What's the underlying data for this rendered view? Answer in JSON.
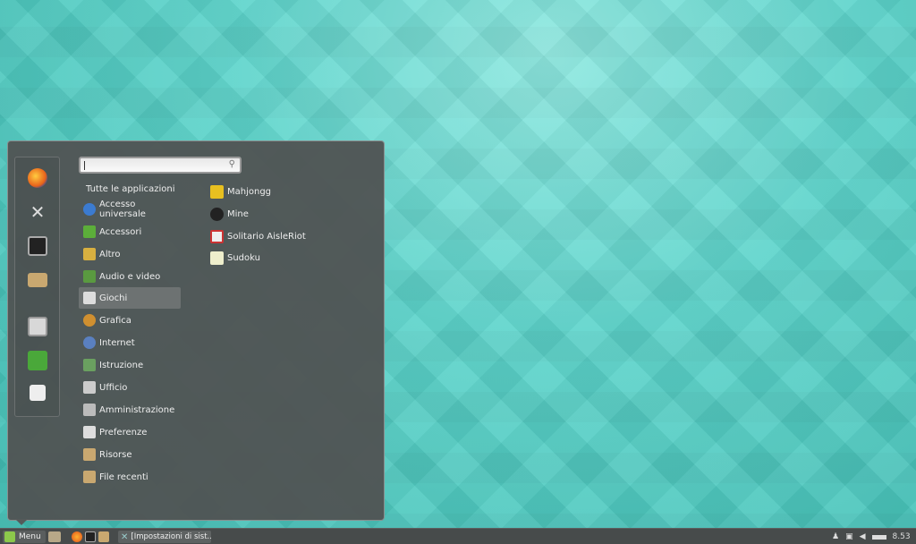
{
  "menu": {
    "search": {
      "placeholder": ""
    },
    "favorites": [
      {
        "name": "firefox-icon"
      },
      {
        "name": "system-settings-icon"
      },
      {
        "name": "terminal-icon"
      },
      {
        "name": "folder-icon"
      },
      {
        "name": "lock-screen-icon"
      },
      {
        "name": "logout-icon"
      },
      {
        "name": "shutdown-icon"
      }
    ],
    "categories": [
      {
        "label": "Tutte le applicazioni"
      },
      {
        "label": "Accesso universale",
        "color": "#3b7bd0"
      },
      {
        "label": "Accessori",
        "color": "#5cae3a"
      },
      {
        "label": "Altro",
        "color": "#d8b040"
      },
      {
        "label": "Audio e video",
        "color": "#5a9a40"
      },
      {
        "label": "Giochi",
        "color": "#dddddd",
        "selected": true
      },
      {
        "label": "Grafica",
        "color": "#d09030"
      },
      {
        "label": "Internet",
        "color": "#5a80c0"
      },
      {
        "label": "Istruzione",
        "color": "#6aa060"
      },
      {
        "label": "Ufficio",
        "color": "#cccccc"
      },
      {
        "label": "Amministrazione",
        "color": "#bbbbbb"
      },
      {
        "label": "Preferenze",
        "color": "#dddddd"
      },
      {
        "label": "Risorse",
        "color": "#c9a870"
      },
      {
        "label": "File recenti",
        "color": "#c9a870"
      }
    ],
    "apps": [
      {
        "label": "Mahjongg",
        "color": "#e8c020"
      },
      {
        "label": "Mine",
        "color": "#222222"
      },
      {
        "label": "Solitario AisleRiot",
        "color": "#e8e8e8"
      },
      {
        "label": "Sudoku",
        "color": "#eeeecc"
      }
    ]
  },
  "taskbar": {
    "menu_label": "Menu",
    "window_label": "[Impostazioni di sist...",
    "clock": "8.53"
  }
}
